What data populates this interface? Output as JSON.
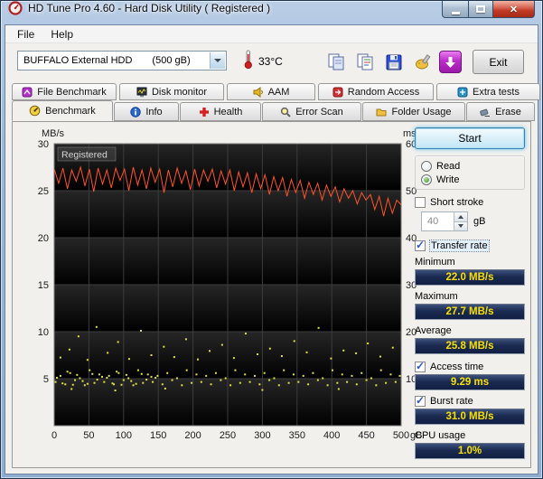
{
  "window": {
    "title": "HD Tune Pro 4.60 - Hard Disk Utility (  Registered )"
  },
  "menu": {
    "file": "File",
    "help": "Help"
  },
  "toolbar": {
    "drive_name": "BUFFALO External HDD",
    "drive_size": "(500 gB)",
    "temperature": "33°C",
    "exit_label": "Exit",
    "buttons": [
      "copy-screenshot",
      "copy-text",
      "save-screenshot",
      "options",
      "update"
    ]
  },
  "tabs_secondary": [
    {
      "label": "File Benchmark"
    },
    {
      "label": "Disk monitor"
    },
    {
      "label": "AAM"
    },
    {
      "label": "Random Access"
    },
    {
      "label": "Extra tests"
    }
  ],
  "tabs_primary": [
    {
      "label": "Benchmark",
      "active": true
    },
    {
      "label": "Info"
    },
    {
      "label": "Health"
    },
    {
      "label": "Error Scan"
    },
    {
      "label": "Folder Usage"
    },
    {
      "label": "Erase"
    }
  ],
  "panel": {
    "start_label": "Start",
    "read_label": "Read",
    "read_selected": false,
    "write_label": "Write",
    "write_selected": true,
    "short_stroke_label": "Short stroke",
    "short_stroke_checked": false,
    "short_stroke_value": "40",
    "short_stroke_unit": "gB",
    "transfer_rate_label": "Transfer rate",
    "transfer_rate_checked": true,
    "minimum_label": "Minimum",
    "minimum_value": "22.0 MB/s",
    "maximum_label": "Maximum",
    "maximum_value": "27.7 MB/s",
    "average_label": "Average",
    "average_value": "25.8 MB/s",
    "access_time_label": "Access time",
    "access_time_checked": true,
    "access_time_value": "9.29 ms",
    "burst_rate_label": "Burst rate",
    "burst_rate_checked": true,
    "burst_rate_value": "31.0 MB/s",
    "cpu_usage_label": "CPU usage",
    "cpu_usage_value": "1.0%"
  },
  "colors": {
    "value_text": "#f8e000",
    "value_bg": "#1b2a50",
    "transfer_line": "#ff5328",
    "access_dots": "#e0e040"
  },
  "chart_data": {
    "type": "line",
    "title": "",
    "watermark": "Registered",
    "grid": true,
    "x_axis": {
      "min": 0,
      "max": 500,
      "unit": "gB",
      "ticks": [
        0,
        50,
        100,
        150,
        200,
        250,
        300,
        350,
        400,
        450,
        500
      ]
    },
    "left_axis": {
      "label": "MB/s",
      "min": 0,
      "max": 30,
      "ticks": [
        30,
        25,
        20,
        15,
        10,
        5
      ]
    },
    "right_axis": {
      "label": "ms",
      "min": 0,
      "max": 60,
      "ticks": [
        60,
        50,
        40,
        30,
        20,
        10
      ]
    },
    "series": [
      {
        "name": "Transfer rate",
        "type": "line",
        "axis": "left",
        "color": "#ff5328",
        "y": [
          27.3,
          25.8,
          27.4,
          25.2,
          27.2,
          26.0,
          27.5,
          25.5,
          27.3,
          24.9,
          27.4,
          25.7,
          27.2,
          25.3,
          27.4,
          26.1,
          27.3,
          25.0,
          27.5,
          25.6,
          27.2,
          25.2,
          27.4,
          25.9,
          27.3,
          24.8,
          27.2,
          25.4,
          27.4,
          25.8,
          27.1,
          25.1,
          27.3,
          25.5,
          27.2,
          26.0,
          27.3,
          25.3,
          27.1,
          25.7,
          27.2,
          25.0,
          27.0,
          25.4,
          26.9,
          24.8,
          26.8,
          25.2,
          26.7,
          24.6,
          26.5,
          25.0,
          26.4,
          24.4,
          26.2,
          24.8,
          26.1,
          24.2,
          25.9,
          24.6,
          25.8,
          24.0,
          25.6,
          24.4,
          25.4,
          23.8,
          25.2,
          24.2,
          25.0,
          23.6,
          24.8,
          24.0,
          24.6,
          23.0,
          24.4,
          22.3,
          24.2,
          22.6,
          24.0,
          23.5
        ]
      },
      {
        "name": "Access time",
        "type": "scatter",
        "axis": "right",
        "color": "#e0e040",
        "points": [
          [
            2,
            9.3
          ],
          [
            9,
            10.6
          ],
          [
            16,
            8.8
          ],
          [
            23,
            11.2
          ],
          [
            30,
            9.7
          ],
          [
            37,
            10.1
          ],
          [
            44,
            8.6
          ],
          [
            51,
            11.8
          ],
          [
            58,
            9.1
          ],
          [
            65,
            10.9
          ],
          [
            72,
            9.3
          ],
          [
            79,
            10.6
          ],
          [
            86,
            8.8
          ],
          [
            93,
            11.2
          ],
          [
            100,
            9.7
          ],
          [
            107,
            10.1
          ],
          [
            114,
            8.6
          ],
          [
            121,
            11.8
          ],
          [
            128,
            9.1
          ],
          [
            135,
            10.9
          ],
          [
            142,
            9.3
          ],
          [
            149,
            10.6
          ],
          [
            156,
            8.8
          ],
          [
            163,
            11.2
          ],
          [
            170,
            9.7
          ],
          [
            177,
            10.1
          ],
          [
            184,
            8.6
          ],
          [
            191,
            11.8
          ],
          [
            198,
            9.1
          ],
          [
            205,
            10.9
          ],
          [
            212,
            9.3
          ],
          [
            219,
            10.6
          ],
          [
            226,
            8.8
          ],
          [
            233,
            11.2
          ],
          [
            240,
            9.7
          ],
          [
            247,
            10.1
          ],
          [
            254,
            8.6
          ],
          [
            261,
            11.8
          ],
          [
            268,
            9.1
          ],
          [
            275,
            10.9
          ],
          [
            282,
            9.3
          ],
          [
            289,
            10.6
          ],
          [
            296,
            8.8
          ],
          [
            303,
            11.2
          ],
          [
            310,
            9.7
          ],
          [
            317,
            10.1
          ],
          [
            324,
            8.6
          ],
          [
            331,
            11.8
          ],
          [
            338,
            9.1
          ],
          [
            345,
            10.9
          ],
          [
            352,
            9.3
          ],
          [
            359,
            10.6
          ],
          [
            366,
            8.8
          ],
          [
            373,
            11.2
          ],
          [
            380,
            9.7
          ],
          [
            387,
            10.1
          ],
          [
            394,
            8.6
          ],
          [
            401,
            11.8
          ],
          [
            408,
            9.1
          ],
          [
            415,
            10.9
          ],
          [
            422,
            9.3
          ],
          [
            429,
            10.6
          ],
          [
            436,
            8.8
          ],
          [
            443,
            11.2
          ],
          [
            450,
            9.7
          ],
          [
            457,
            10.1
          ],
          [
            464,
            8.6
          ],
          [
            471,
            11.8
          ],
          [
            478,
            9.1
          ],
          [
            485,
            10.9
          ],
          [
            492,
            9.3
          ],
          [
            498,
            10.6
          ],
          [
            4,
            10.2
          ],
          [
            12,
            9.0
          ],
          [
            19,
            11.5
          ],
          [
            27,
            8.7
          ],
          [
            33,
            10.8
          ],
          [
            41,
            9.5
          ],
          [
            48,
            8.9
          ],
          [
            55,
            11.0
          ],
          [
            62,
            9.8
          ],
          [
            69,
            10.4
          ],
          [
            76,
            10.2
          ],
          [
            84,
            9.0
          ],
          [
            90,
            11.5
          ],
          [
            97,
            8.7
          ],
          [
            104,
            10.8
          ],
          [
            111,
            9.5
          ],
          [
            118,
            8.9
          ],
          [
            126,
            11.0
          ],
          [
            133,
            9.8
          ],
          [
            140,
            10.4
          ],
          [
            146,
            10.2
          ],
          [
            9,
            14.5
          ],
          [
            22,
            16.2
          ],
          [
            35,
            19.0
          ],
          [
            48,
            14.0
          ],
          [
            61,
            21.0
          ],
          [
            77,
            15.5
          ],
          [
            92,
            17.8
          ],
          [
            108,
            14.2
          ],
          [
            125,
            20.2
          ],
          [
            140,
            15.0
          ],
          [
            158,
            16.8
          ],
          [
            173,
            14.6
          ],
          [
            190,
            18.4
          ],
          [
            207,
            14.1
          ],
          [
            224,
            15.9
          ],
          [
            242,
            17.2
          ],
          [
            259,
            14.4
          ],
          [
            276,
            19.6
          ],
          [
            293,
            15.2
          ],
          [
            311,
            16.4
          ],
          [
            328,
            14.8
          ],
          [
            346,
            18.0
          ],
          [
            364,
            15.6
          ],
          [
            381,
            20.8
          ],
          [
            399,
            14.3
          ],
          [
            417,
            16.0
          ],
          [
            435,
            15.4
          ],
          [
            452,
            17.5
          ],
          [
            470,
            14.7
          ],
          [
            488,
            16.6
          ],
          [
            25,
            7.8
          ],
          [
            88,
            7.5
          ],
          [
            160,
            7.9
          ],
          [
            300,
            7.6
          ],
          [
            410,
            7.8
          ]
        ]
      }
    ]
  }
}
